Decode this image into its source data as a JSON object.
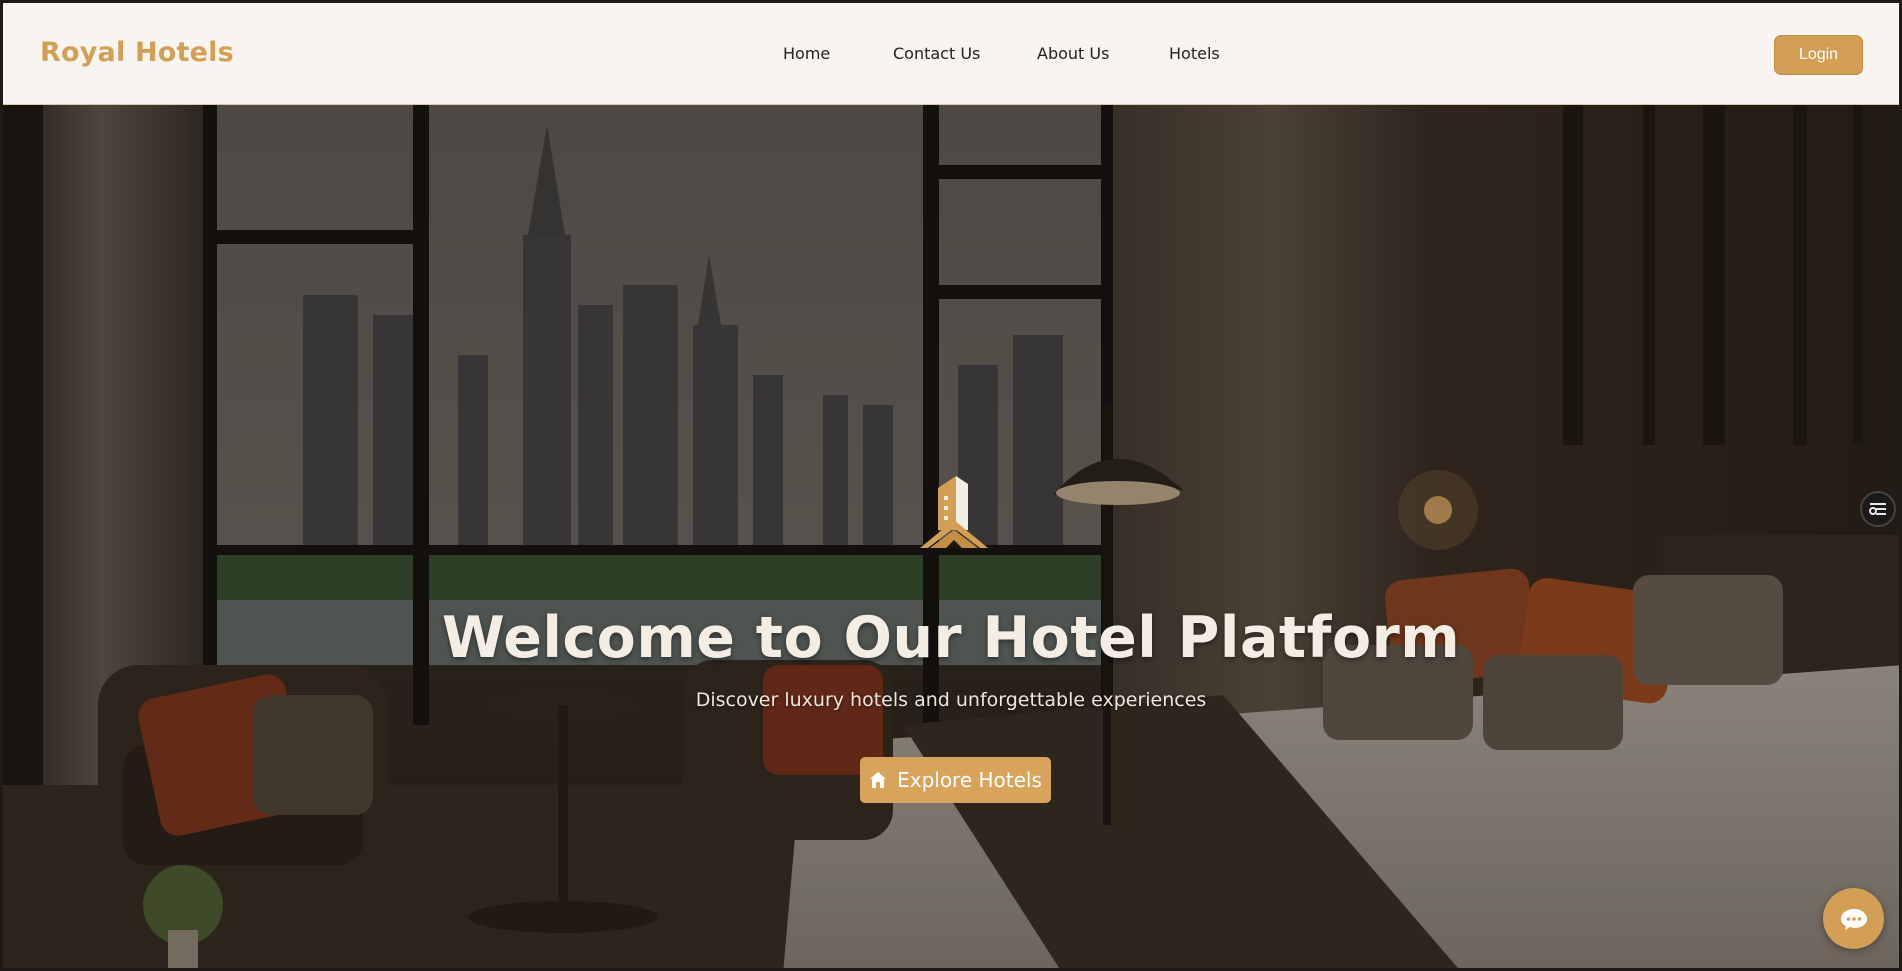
{
  "header": {
    "brand": "Royal Hotels",
    "nav": [
      {
        "label": "Home"
      },
      {
        "label": "Contact Us"
      },
      {
        "label": "About Us"
      },
      {
        "label": "Hotels"
      }
    ],
    "login_label": "Login"
  },
  "hero": {
    "title": "Welcome to Our Hotel Platform",
    "subtitle": "Discover luxury hotels and unforgettable experiences",
    "cta_label": "Explore Hotels",
    "cta_icon": "home-icon",
    "logo_icon": "hotel-building-logo-icon"
  },
  "floating": {
    "side_widget_icon": "settings-list-icon",
    "chat_icon": "chat-bubble-icon"
  },
  "colors": {
    "accent": "#d29f54",
    "header_bg": "#f8f5f1",
    "title_text": "#f4ede4"
  }
}
